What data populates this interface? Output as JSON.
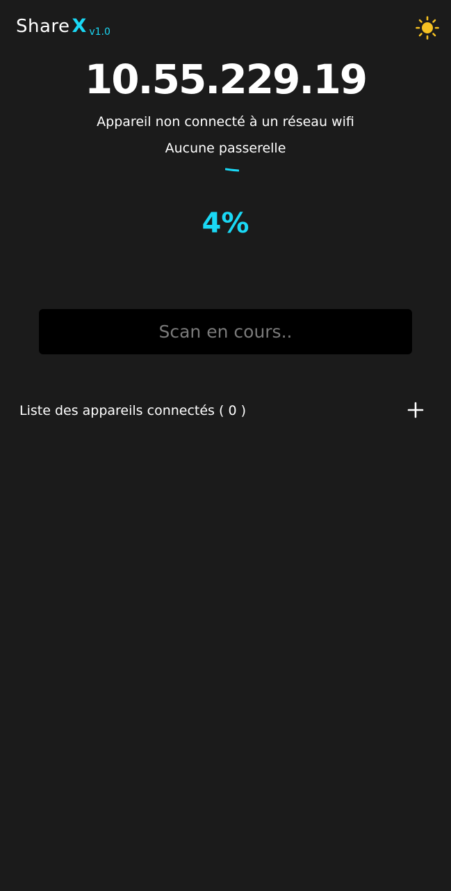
{
  "header": {
    "brand_text": "Share",
    "brand_mark": "X",
    "version": "v1.0",
    "theme_icon": "sun-icon"
  },
  "network": {
    "ip_address": "10.55.229.19",
    "wifi_status": "Appareil non connecté à un réseau wifi",
    "gateway_status": "Aucune passerelle"
  },
  "scan": {
    "progress_percent": 4,
    "progress_label": "4%",
    "button_label": "Scan en cours.."
  },
  "devices": {
    "list_label": "Liste des appareils connectés ( 0 )",
    "add_icon": "plus-icon"
  },
  "colors": {
    "background": "#1b1b1b",
    "accent": "#1ad8f5",
    "sun": "#f5c122",
    "button_bg": "#000000",
    "button_text": "#7a7a7a"
  }
}
